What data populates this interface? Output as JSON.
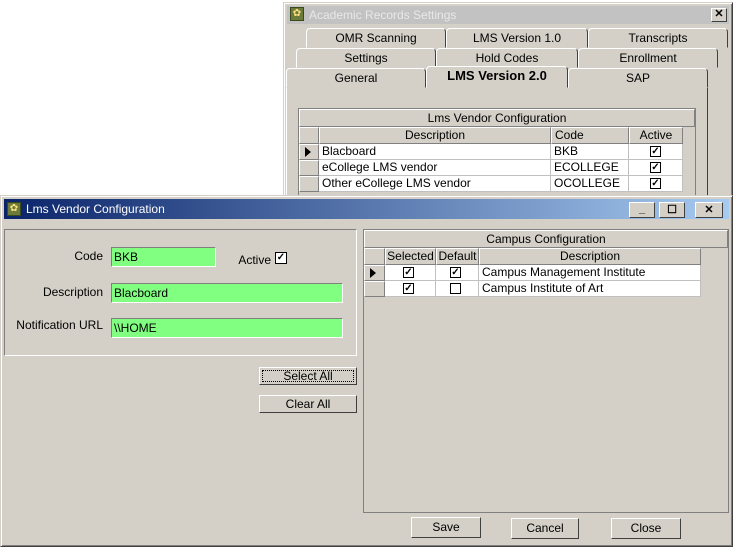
{
  "settings_window": {
    "title": "Academic Records Settings",
    "close_glyph": "✕",
    "tabs_row1": [
      "OMR Scanning",
      "LMS Version 1.0",
      "Transcripts"
    ],
    "tabs_row2": [
      "Settings",
      "Hold Codes",
      "Enrollment"
    ],
    "tabs_row3": [
      "General",
      "LMS Version 2.0",
      "SAP"
    ],
    "selected_tab": "LMS Version 2.0",
    "grid_title": "Lms Vendor Configuration",
    "columns": [
      "Description",
      "Code",
      "Active"
    ],
    "rows": [
      {
        "description": "Blacboard",
        "code": "BKB",
        "active": "✓"
      },
      {
        "description": "eCollege LMS vendor",
        "code": "ECOLLEGE",
        "active": "✓"
      },
      {
        "description": "Other eCollege LMS vendor",
        "code": "OCOLLEGE",
        "active": "✓"
      }
    ]
  },
  "dialog": {
    "title": "Lms Vendor Configuration",
    "min_glyph": "_",
    "max_glyph": "☐",
    "close_glyph": "✕",
    "code_label": "Code",
    "code_value": "BKB",
    "active_label": "Active",
    "active_check": "✓",
    "description_label": "Description",
    "description_value": "Blacboard",
    "url_label": "Notification URL",
    "url_value": "\\\\HOME",
    "select_all": "Select All",
    "clear_all": "Clear All",
    "campus_title": "Campus Configuration",
    "campus_columns": [
      "Selected",
      "Default",
      "Description"
    ],
    "campus_rows": [
      {
        "selected": "✓",
        "default": "✓",
        "description": "Campus Management Institute"
      },
      {
        "selected": "✓",
        "default": "",
        "description": "Campus Institute of Art"
      }
    ],
    "save": "Save",
    "cancel": "Cancel",
    "close": "Close"
  }
}
